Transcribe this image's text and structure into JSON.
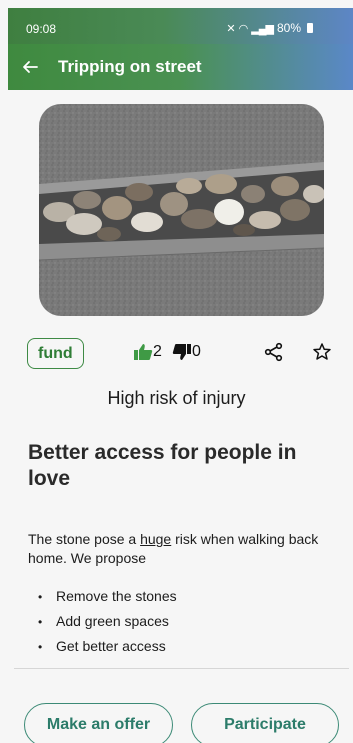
{
  "status": {
    "time": "09:08",
    "battery": "80%"
  },
  "appbar": {
    "back_icon": "arrow-left-icon",
    "title": "Tripping on street"
  },
  "chip": {
    "label": "fund"
  },
  "votes": {
    "up_count": "2",
    "down_count": "0",
    "up_color": "#3f9a45"
  },
  "risk_text": "High risk of injury",
  "heading": "Better access for people in love",
  "description": {
    "part1": "The stone pose a ",
    "highlight": "huge",
    "part2": " risk when walking back home. We propose"
  },
  "bullets": [
    "Remove the stones",
    "Add green spaces",
    "Get better access"
  ],
  "buttons": {
    "offer": "Make an offer",
    "participate": "Participate"
  },
  "colors": {
    "primary_green": "#3e8a45",
    "accent_teal": "#3c8a76"
  }
}
